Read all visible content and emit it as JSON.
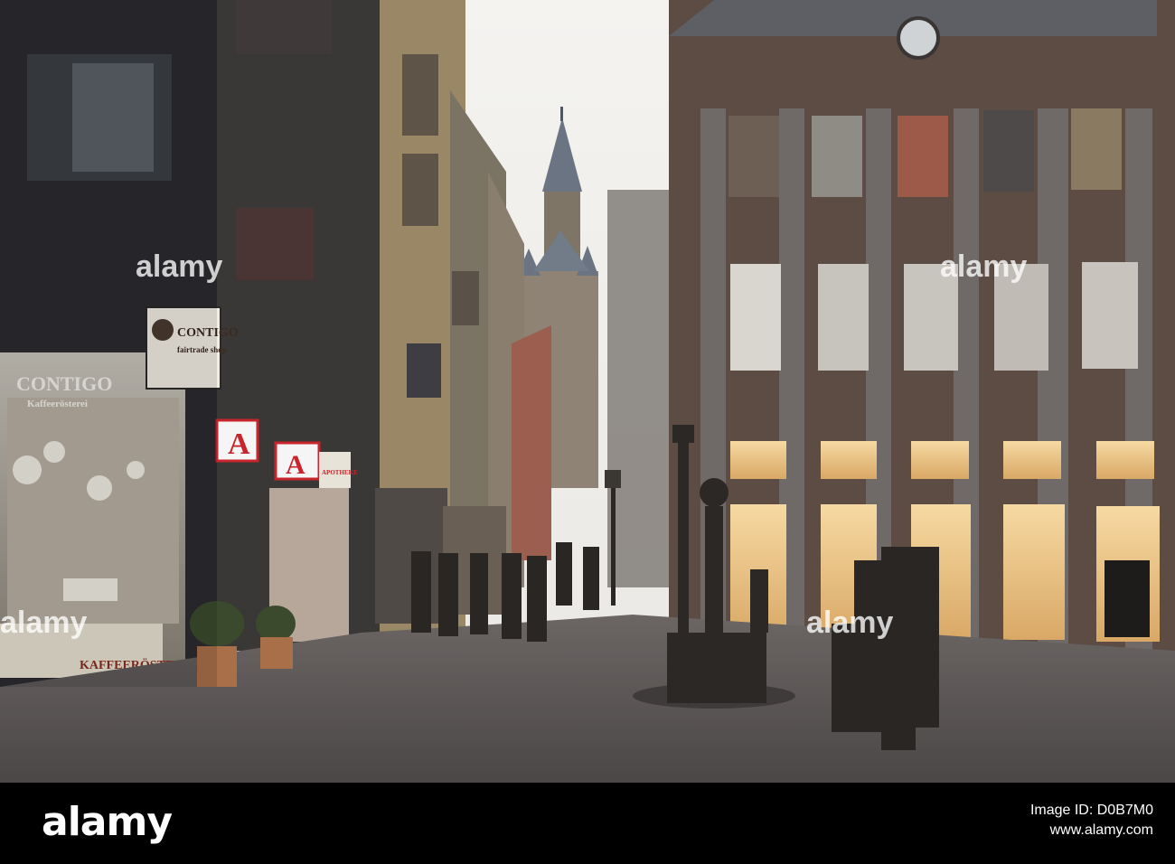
{
  "photo": {
    "description_icon": "street-photo",
    "shop_signs": {
      "contigo_main": "CONTIGO",
      "contigo_sub": "fairtrade shop",
      "contigo_window": "CONTIGO",
      "contigo_window_sub": "Kaffeerösterei",
      "kaffee": "KAFFEERÖSTEREI",
      "apotheke_symbol": "A",
      "apotheke_label": "APOTHEKE"
    }
  },
  "watermark": {
    "text": "alamy"
  },
  "footer": {
    "logo": "alamy",
    "image_id_label": "Image ID: D0B7M0",
    "url": "www.alamy.com"
  },
  "colors": {
    "footer_bg": "#000000",
    "sky": "#f3f2ee",
    "pavement": "#5a5655",
    "apotheke_red": "#c8242b"
  }
}
